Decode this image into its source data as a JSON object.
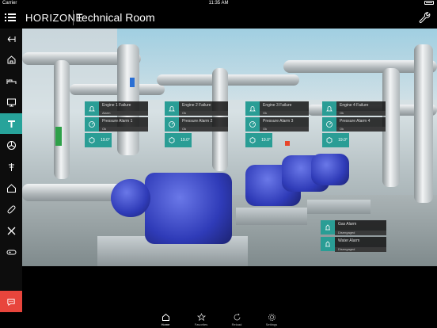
{
  "status_bar": {
    "carrier": "Carrier",
    "time": "11:35 AM"
  },
  "header": {
    "logo": "HORIZONE",
    "title": "Technical Room"
  },
  "sidebar": {
    "items": [
      {
        "icon": "back-icon"
      },
      {
        "icon": "home-icon"
      },
      {
        "icon": "bed-icon"
      },
      {
        "icon": "monitor-icon"
      },
      {
        "icon": "tools-icon",
        "active": true
      },
      {
        "icon": "fan-icon"
      },
      {
        "icon": "antenna-icon"
      },
      {
        "icon": "house-icon"
      },
      {
        "icon": "bandage-icon"
      },
      {
        "icon": "crossed-tools-icon"
      },
      {
        "icon": "gamepad-icon"
      }
    ],
    "chat_icon": "chat-icon"
  },
  "pump_panels": [
    {
      "engine": "Engine 1 Failure",
      "engine_state": "Alarm",
      "pressure": "Pressure Alarm 1",
      "pressure_state": "Ok",
      "temp": "19.0°"
    },
    {
      "engine": "Engine 2 Failure",
      "engine_state": "Ok",
      "pressure": "Pressure Alarm 2",
      "pressure_state": "Ok",
      "temp": "19.0°"
    },
    {
      "engine": "Engine 3 Failure",
      "engine_state": "Ok",
      "pressure": "Pressure Alarm 3",
      "pressure_state": "Ok",
      "temp": "19.0°"
    },
    {
      "engine": "Engine 4 Failure",
      "engine_state": "Ok",
      "pressure": "Pressure Alarm 4",
      "pressure_state": "Ok",
      "temp": "19.0°"
    }
  ],
  "alarms": [
    {
      "label": "Gas Alarm",
      "state": "Disengaged"
    },
    {
      "label": "Water Alarm",
      "state": "Disengaged"
    }
  ],
  "tabbar": {
    "items": [
      {
        "label": "Home",
        "icon": "home-icon",
        "active": true
      },
      {
        "label": "Favorites",
        "icon": "star-icon"
      },
      {
        "label": "Reload",
        "icon": "reload-icon"
      },
      {
        "label": "Settings",
        "icon": "gear-icon"
      }
    ]
  },
  "colors": {
    "accent": "#27a39a",
    "chat": "#e8453c",
    "motor": "#2f3bb8"
  }
}
